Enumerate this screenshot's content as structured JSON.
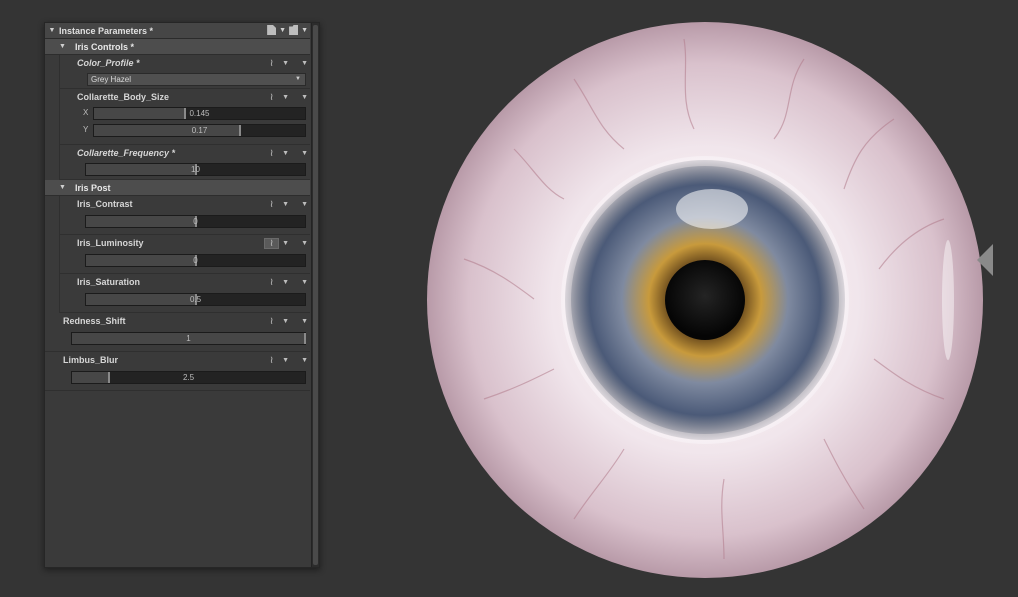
{
  "panel": {
    "title": "Instance Parameters *",
    "groups": {
      "iris_controls": {
        "label": "Iris Controls *"
      },
      "iris_post": {
        "label": "Iris Post"
      }
    },
    "params": {
      "color_profile": {
        "label": "Color_Profile *",
        "value": "Grey Hazel"
      },
      "collarette_body_size": {
        "label": "Collarette_Body_Size",
        "x_axis": "X",
        "x_value": "0.145",
        "x_fraction": 0.43,
        "y_axis": "Y",
        "y_value": "0.17",
        "y_fraction": 0.69
      },
      "collarette_frequency": {
        "label": "Collarette_Frequency *",
        "value": "10",
        "fraction": 0.5
      },
      "iris_contrast": {
        "label": "Iris_Contrast",
        "value": "0",
        "fraction": 0.5
      },
      "iris_luminosity": {
        "label": "Iris_Luminosity",
        "value": "0",
        "fraction": 0.5
      },
      "iris_saturation": {
        "label": "Iris_Saturation",
        "value": "0.5",
        "fraction": 0.5
      },
      "redness_shift": {
        "label": "Redness_Shift",
        "value": "1",
        "fraction": 1.0
      },
      "limbus_blur": {
        "label": "Limbus_Blur",
        "value": "2.5",
        "fraction": 0.16
      }
    },
    "icons": {
      "header": [
        "document-icon",
        "folder-icon"
      ],
      "param": "curve-icon"
    }
  },
  "colors": {
    "background": "#343434",
    "panel": "#3a3a3a",
    "iris_outer": "#4b5a78",
    "iris_inner": "#c89a3c",
    "sclera": "#f1e6ec"
  }
}
